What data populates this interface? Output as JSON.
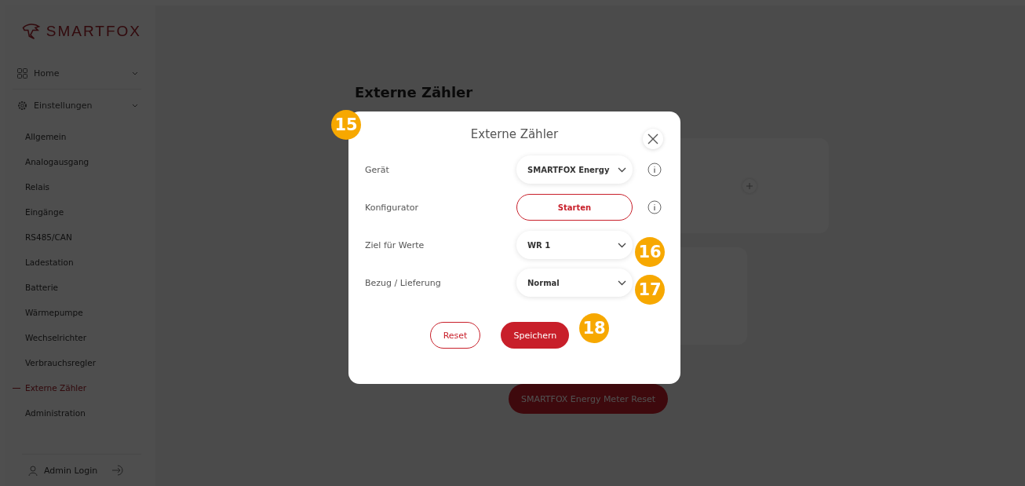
{
  "sidebar": {
    "logo": "SMARTFOX",
    "nav": [
      {
        "label": "Home",
        "expanded": false
      },
      {
        "label": "Einstellungen",
        "expanded": false
      }
    ],
    "items": [
      {
        "label": "Allgemein",
        "selected": false
      },
      {
        "label": "Analogausgang",
        "selected": false
      },
      {
        "label": "Relais",
        "selected": false
      },
      {
        "label": "Eingänge",
        "selected": false
      },
      {
        "label": "RS485/CAN",
        "selected": false
      },
      {
        "label": "Ladestation",
        "selected": false
      },
      {
        "label": "Batterie",
        "selected": false
      },
      {
        "label": "Wärmepumpe",
        "selected": false
      },
      {
        "label": "Wechselrichter",
        "selected": false
      },
      {
        "label": "Verbrauchsregler",
        "selected": false
      },
      {
        "label": "Externe Zähler",
        "selected": true
      },
      {
        "label": "Administration",
        "selected": false
      }
    ],
    "footer": {
      "label": "Admin Login"
    }
  },
  "page": {
    "title": "Externe Zähler",
    "reset_button": "SMARTFOX Energy Meter Reset"
  },
  "dialog": {
    "title": "Externe Zähler",
    "rows": [
      {
        "label": "Gerät",
        "kind": "select",
        "value": "SMARTFOX Energy",
        "info": true
      },
      {
        "label": "Konfigurator",
        "kind": "button",
        "value": "Starten",
        "info": true
      },
      {
        "label": "Ziel für Werte",
        "kind": "select",
        "value": "WR 1",
        "info": false
      },
      {
        "label": "Bezug / Lieferung",
        "kind": "select",
        "value": "Normal",
        "info": false
      }
    ],
    "buttons": [
      {
        "label": "Reset",
        "kind": "outline"
      },
      {
        "label": "Speichern",
        "kind": "primary"
      }
    ]
  },
  "callouts": [
    "15",
    "16",
    "17",
    "18"
  ]
}
